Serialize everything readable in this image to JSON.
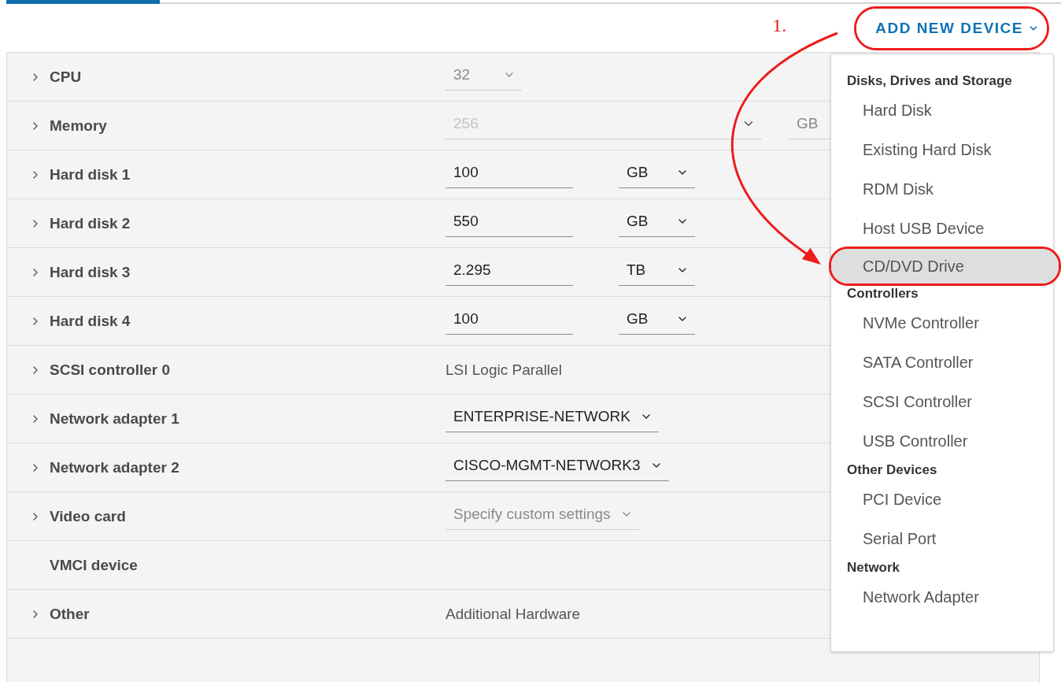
{
  "tabs": [
    {
      "selected": true
    },
    {
      "selected": false
    }
  ],
  "annotation": {
    "step_label": "1."
  },
  "add_button": {
    "label": "ADD NEW DEVICE",
    "highlighted": true
  },
  "rows": [
    {
      "label": "CPU",
      "expandable": true,
      "value": {
        "kind": "select",
        "text": "32",
        "disabled": true
      }
    },
    {
      "label": "Memory",
      "expandable": true,
      "value": {
        "kind": "memory",
        "text": "256",
        "unit": "GB",
        "disabled": true
      }
    },
    {
      "label": "Hard disk 1",
      "expandable": true,
      "value": {
        "kind": "size",
        "text": "100",
        "unit": "GB"
      }
    },
    {
      "label": "Hard disk 2",
      "expandable": true,
      "value": {
        "kind": "size",
        "text": "550",
        "unit": "GB"
      }
    },
    {
      "label": "Hard disk 3",
      "expandable": true,
      "value": {
        "kind": "size",
        "text": "2.295",
        "unit": "TB"
      }
    },
    {
      "label": "Hard disk 4",
      "expandable": true,
      "value": {
        "kind": "size",
        "text": "100",
        "unit": "GB"
      }
    },
    {
      "label": "SCSI controller 0",
      "expandable": true,
      "value": {
        "kind": "text",
        "text": "LSI Logic Parallel"
      }
    },
    {
      "label": "Network adapter 1",
      "expandable": true,
      "value": {
        "kind": "select",
        "text": "ENTERPRISE-NETWORK",
        "disabled": false
      }
    },
    {
      "label": "Network adapter 2",
      "expandable": true,
      "value": {
        "kind": "select",
        "text": "CISCO-MGMT-NETWORK3",
        "disabled": false
      }
    },
    {
      "label": "Video card",
      "expandable": true,
      "value": {
        "kind": "select",
        "text": "Specify custom settings",
        "disabled": true
      }
    },
    {
      "label": "VMCI device",
      "expandable": false
    },
    {
      "label": "Other",
      "expandable": true,
      "value": {
        "kind": "text",
        "text": "Additional Hardware"
      }
    }
  ],
  "menu": {
    "sections": [
      {
        "title": "Disks, Drives and Storage",
        "items": [
          {
            "label": "Hard Disk",
            "selected": false,
            "highlighted": false
          },
          {
            "label": "Existing Hard Disk",
            "selected": false,
            "highlighted": false
          },
          {
            "label": "RDM Disk",
            "selected": false,
            "highlighted": false
          },
          {
            "label": "Host USB Device",
            "selected": false,
            "highlighted": false
          },
          {
            "label": "CD/DVD Drive",
            "selected": true,
            "highlighted": true
          }
        ]
      },
      {
        "title": "Controllers",
        "items": [
          {
            "label": "NVMe Controller",
            "selected": false,
            "highlighted": false
          },
          {
            "label": "SATA Controller",
            "selected": false,
            "highlighted": false
          },
          {
            "label": "SCSI Controller",
            "selected": false,
            "highlighted": false
          },
          {
            "label": "USB Controller",
            "selected": false,
            "highlighted": false
          }
        ]
      },
      {
        "title": "Other Devices",
        "items": [
          {
            "label": "PCI Device",
            "selected": false,
            "highlighted": false
          },
          {
            "label": "Serial Port",
            "selected": false,
            "highlighted": false
          }
        ]
      },
      {
        "title": "Network",
        "items": [
          {
            "label": "Network Adapter",
            "selected": false,
            "highlighted": false
          }
        ]
      }
    ]
  }
}
